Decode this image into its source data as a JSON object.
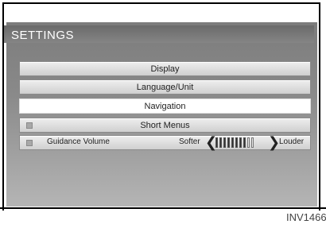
{
  "header": {
    "title": "SETTINGS"
  },
  "menu": {
    "items": [
      {
        "label": "Display"
      },
      {
        "label": "Language/Unit"
      },
      {
        "label": "Navigation",
        "selected": true
      },
      {
        "label": "Short Menus"
      }
    ]
  },
  "volume": {
    "label": "Guidance Volume",
    "softer": "Softer",
    "louder": "Louder",
    "level_fraction": 0.8,
    "level_steps": 8,
    "total_steps": 10
  },
  "caption": "INV1466"
}
